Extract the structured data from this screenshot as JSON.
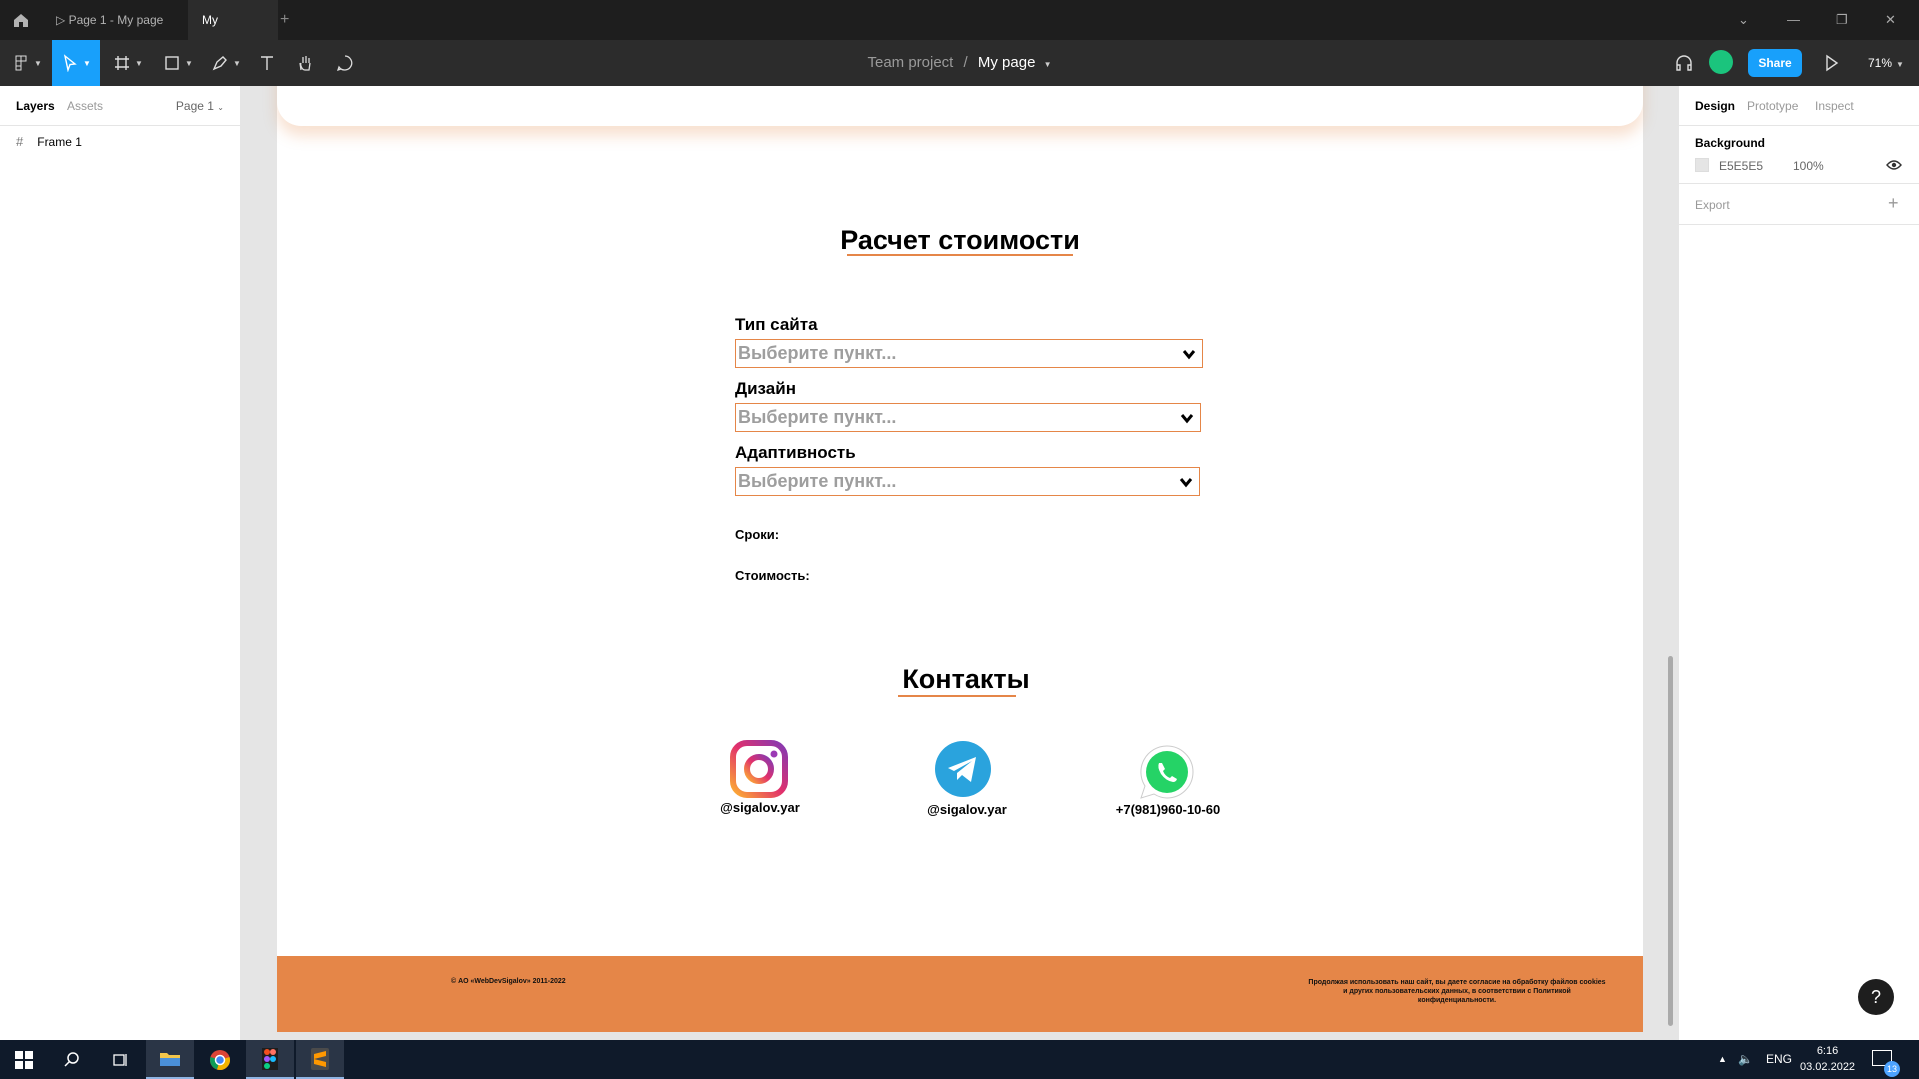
{
  "titlebar": {
    "tab1_label": "Page 1 - My page",
    "tab2_label": "My page"
  },
  "toolbar": {
    "breadcrumb_project": "Team project",
    "breadcrumb_sep": "/",
    "breadcrumb_page": "My page",
    "share_label": "Share",
    "zoom": "71%"
  },
  "left_panel": {
    "tab_layers": "Layers",
    "tab_assets": "Assets",
    "page_selector": "Page 1",
    "layers": [
      {
        "name": "Frame 1"
      }
    ]
  },
  "right_panel": {
    "tab_design": "Design",
    "tab_prototype": "Prototype",
    "tab_inspect": "Inspect",
    "background_title": "Background",
    "background_hex": "E5E5E5",
    "background_opacity": "100%",
    "export_title": "Export",
    "help": "?"
  },
  "page": {
    "calc_title": "Расчет стоимости",
    "fields": [
      {
        "label": "Тип сайта",
        "placeholder": "Выберите пункт..."
      },
      {
        "label": "Дизайн",
        "placeholder": "Выберите пункт..."
      },
      {
        "label": "Адаптивность",
        "placeholder": "Выберите пункт..."
      }
    ],
    "term_label": "Сроки:",
    "price_label": "Стоимость:",
    "contacts_title": "Контакты",
    "contacts": [
      {
        "icon": "instagram-icon",
        "label": "@sigalov.yar"
      },
      {
        "icon": "telegram-icon",
        "label": "@sigalov.yar"
      },
      {
        "icon": "whatsapp-icon",
        "label": "+7(981)960-10-60"
      }
    ],
    "footer_copy": "© АО «WebDevSigalov» 2011-2022",
    "footer_notice": "Продолжая использовать наш сайт, вы даете согласие на обработку файлов cookies и других пользовательских данных, в соответствии с Политикой конфиденциальности."
  },
  "taskbar": {
    "lang": "ENG",
    "time": "6:16",
    "date": "03.02.2022",
    "notifications": "13"
  },
  "colors": {
    "accent": "#e58648",
    "figma_blue": "#18a0fb",
    "canvas_bg": "#e5e5e5"
  }
}
